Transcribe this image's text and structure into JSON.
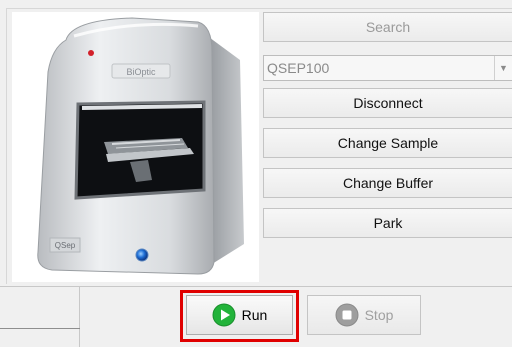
{
  "device_panel": {
    "image_alt": "QSEP100 instrument",
    "brand_text": "QSep",
    "icons": {
      "device": "instrument-illustration-icon"
    }
  },
  "controls": {
    "search_label": "Search",
    "instrument_select": {
      "value": "QSEP100",
      "arrow": "chevron-down-icon"
    },
    "disconnect_label": "Disconnect",
    "change_sample_label": "Change Sample",
    "change_buffer_label": "Change Buffer",
    "park_label": "Park"
  },
  "run_bar": {
    "run_label": "Run",
    "stop_label": "Stop",
    "icons": {
      "run": "play-circle-icon",
      "stop": "stop-circle-icon"
    },
    "colors": {
      "run_icon": "#22b33a",
      "stop_icon": "#9e9e9e",
      "highlight": "#e00000"
    }
  }
}
